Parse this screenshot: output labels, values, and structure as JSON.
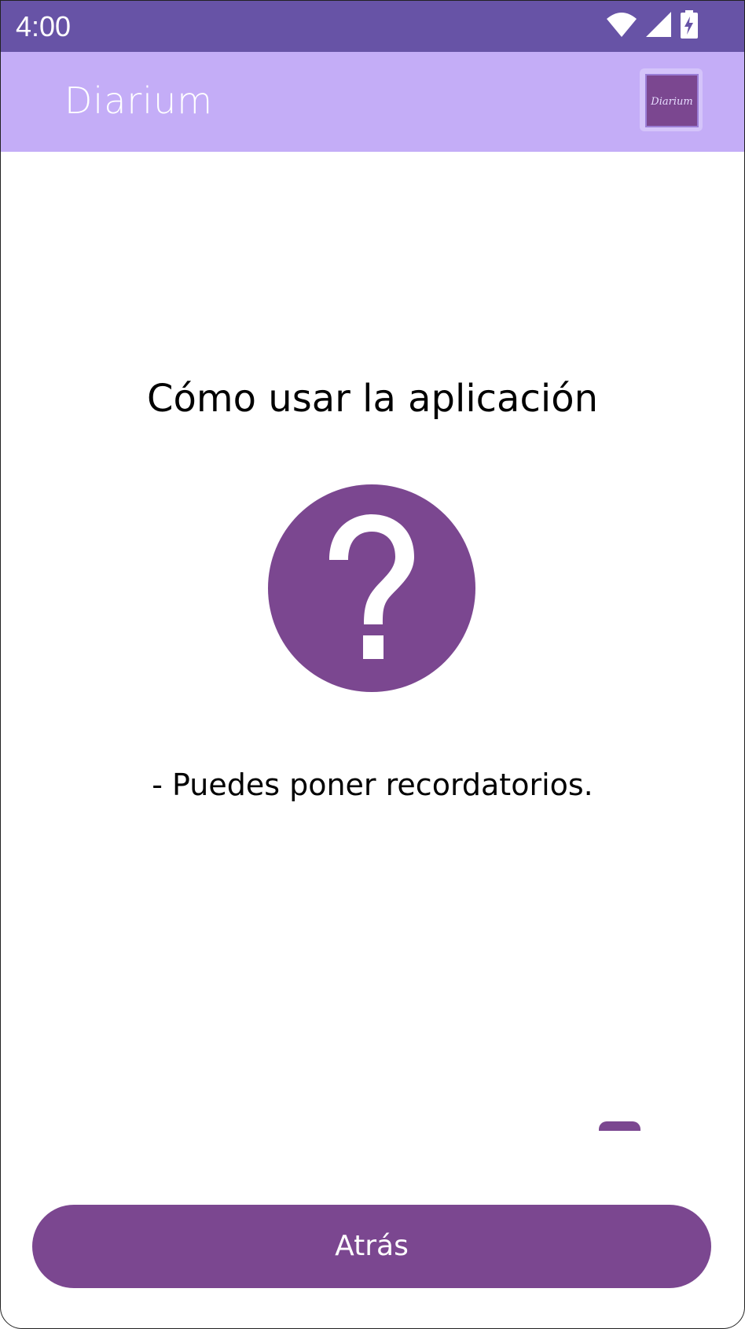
{
  "status_bar": {
    "time": "4:00",
    "icons": [
      "wifi-icon",
      "signal-icon",
      "battery-charging-icon"
    ]
  },
  "app_bar": {
    "title": "Diarium",
    "logo_text": "Diarium"
  },
  "content": {
    "heading": "Cómo usar la aplicación",
    "icon": "help-circle-icon",
    "tip": "- Puedes poner recordatorios."
  },
  "actions": {
    "back_label": "Atrás"
  },
  "colors": {
    "status_bar": "#6753a6",
    "app_bar": "#c4adf7",
    "accent": "#7b4790",
    "text": "#000000",
    "on_accent": "#ffffff"
  }
}
